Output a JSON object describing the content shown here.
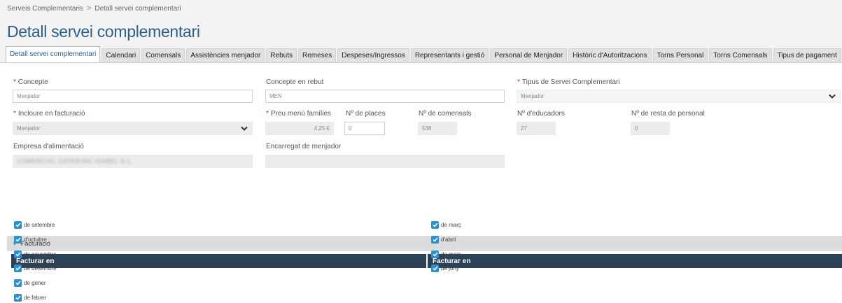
{
  "breadcrumb": {
    "parent": "Serveis Complementaris",
    "separator": ">",
    "current": "Detall servei complementari"
  },
  "page_title": "Detall servei complementari",
  "tabs": [
    {
      "label": "Detall servei complementari",
      "active": true
    },
    {
      "label": "Calendari"
    },
    {
      "label": "Comensals"
    },
    {
      "label": "Assistències menjador"
    },
    {
      "label": "Rebuts"
    },
    {
      "label": "Remeses"
    },
    {
      "label": "Despeses/Ingressos"
    },
    {
      "label": "Representants i gestió"
    },
    {
      "label": "Personal de Menjador"
    },
    {
      "label": "Històric d'Autoritzacions"
    },
    {
      "label": "Torns Personal"
    },
    {
      "label": "Torns Comensals"
    },
    {
      "label": "Tipus de pagament"
    }
  ],
  "form": {
    "concepte": {
      "label": "Concepte",
      "required": "*",
      "value": "Menjador"
    },
    "concepte_rebut": {
      "label": "Concepte en rebut",
      "value": "MEN"
    },
    "tipus_servei": {
      "label": "Tipus de Servei Complementari",
      "required": "*",
      "value": "Menjador"
    },
    "incloure_facturacio": {
      "label": "Incloure en facturació",
      "required": "*",
      "value": "Menjador"
    },
    "preu_menu": {
      "label": "Preu menú famílies",
      "required": "*",
      "value": "4,25 €"
    },
    "num_places": {
      "label": "Nº de places",
      "value": "0"
    },
    "num_comensals": {
      "label": "Nº de comensals",
      "value": "538"
    },
    "num_educadors": {
      "label": "Nº d'educadors",
      "value": "27"
    },
    "num_resta_personal": {
      "label": "Nº de resta de personal",
      "value": "0"
    },
    "empresa_alimentacio": {
      "label": "Empresa d'alimentació",
      "value": "COMERCIAL CATERING ISABEL S.L."
    },
    "encarregat_menjador": {
      "label": "Encarregat de menjador",
      "value": ""
    }
  },
  "facturacio": {
    "section_label": "Facturació",
    "column_header": "Facturar en",
    "left_months": [
      "de setembre",
      "d'octubre",
      "de novembre",
      "de desembre",
      "de gener",
      "de febrer"
    ],
    "right_months": [
      "de març",
      "d'abril",
      "de maig",
      "de juny"
    ]
  },
  "colors": {
    "accent": "#2a5f8a",
    "header_dark": "#2c4257",
    "checkbox": "#2d8fcf",
    "required": "#d9232e"
  }
}
